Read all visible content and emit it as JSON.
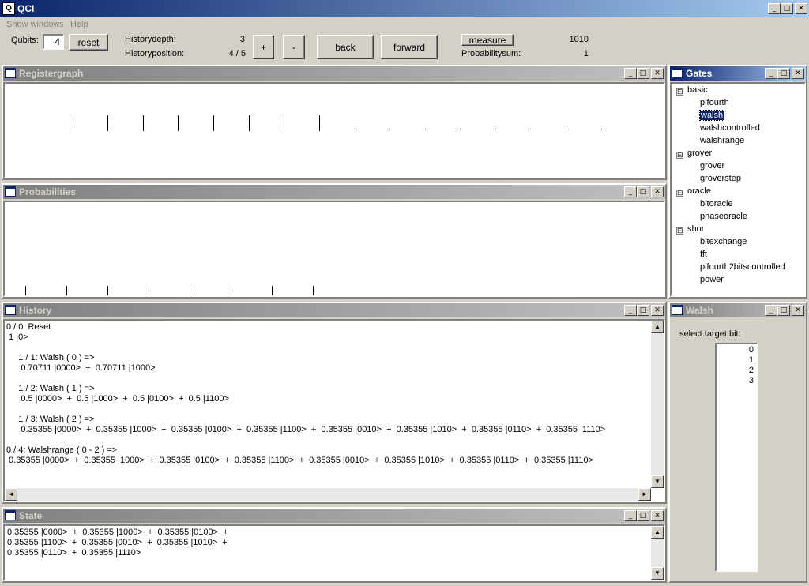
{
  "app": {
    "title": "QCI",
    "icon_text": "Q"
  },
  "menu": {
    "show_windows": "Show windows",
    "help": "Help"
  },
  "toolbar": {
    "qubits_label": "Qubits:",
    "qubits_value": "4",
    "reset_label": "reset",
    "historydepth_label": "Historydepth:",
    "historydepth_value": "3",
    "historyposition_label": "Historyposition:",
    "historyposition_value": "4 / 5",
    "plus_label": "+",
    "minus_label": "-",
    "back_label": "back",
    "forward_label": "forward",
    "measure_label": "measure",
    "measure_value": "1010",
    "probabilitysum_label": "Probabilitysum:",
    "probabilitysum_value": "1"
  },
  "windows": {
    "registergraph": "Registergraph",
    "probabilities": "Probabilities",
    "history": "History",
    "state": "State",
    "gates": "Gates",
    "walsh": "Walsh"
  },
  "history_lines": [
    "0 / 0: Reset",
    " 1 |0>",
    "",
    "     1 / 1: Walsh ( 0 ) =>",
    "      0.70711 |0000>  +  0.70711 |1000>",
    "",
    "     1 / 2: Walsh ( 1 ) =>",
    "      0.5 |0000>  +  0.5 |1000>  +  0.5 |0100>  +  0.5 |1100>",
    "",
    "     1 / 3: Walsh ( 2 ) =>",
    "      0.35355 |0000>  +  0.35355 |1000>  +  0.35355 |0100>  +  0.35355 |1100>  +  0.35355 |0010>  +  0.35355 |1010>  +  0.35355 |0110>  +  0.35355 |1110>",
    "",
    "0 / 4: Walshrange ( 0 - 2 ) =>",
    " 0.35355 |0000>  +  0.35355 |1000>  +  0.35355 |0100>  +  0.35355 |1100>  +  0.35355 |0010>  +  0.35355 |1010>  +  0.35355 |0110>  +  0.35355 |1110>"
  ],
  "state_lines": [
    "0.35355 |0000>  +  0.35355 |1000>  +  0.35355 |0100>  +",
    "0.35355 |1100>  +  0.35355 |0010>  +  0.35355 |1010>  +",
    "0.35355 |0110>  +  0.35355 |1110>"
  ],
  "gates_tree": {
    "basic": "basic",
    "basic_items": [
      "pifourth",
      "walsh",
      "walshcontrolled",
      "walshrange"
    ],
    "grover": "grover",
    "grover_items": [
      "grover",
      "groverstep"
    ],
    "oracle": "oracle",
    "oracle_items": [
      "bitoracle",
      "phaseoracle"
    ],
    "shor": "shor",
    "shor_items": [
      "bitexchange",
      "fft",
      "pifourth2bitscontrolled",
      "power"
    ],
    "toggle": "⊟"
  },
  "walsh_panel": {
    "select_label": "select target bit:",
    "bits": [
      "0",
      "1",
      "2",
      "3"
    ]
  },
  "winbtn": {
    "min": "_",
    "max": "□",
    "close": "✕"
  },
  "scroll": {
    "up": "▲",
    "down": "▼",
    "left": "◄",
    "right": "►"
  },
  "registergraph": {
    "amplitudes": [
      0,
      0.35355,
      0.35355,
      0.35355,
      0.35355,
      0.35355,
      0.35355,
      0.35355,
      0.35355,
      0,
      0,
      0,
      0,
      0,
      0,
      0,
      0
    ]
  },
  "probabilities": {
    "values": [
      0,
      0.125,
      0.125,
      0.125,
      0.125,
      0.125,
      0.125,
      0.125,
      0.125,
      0,
      0,
      0,
      0,
      0,
      0,
      0,
      0
    ]
  }
}
